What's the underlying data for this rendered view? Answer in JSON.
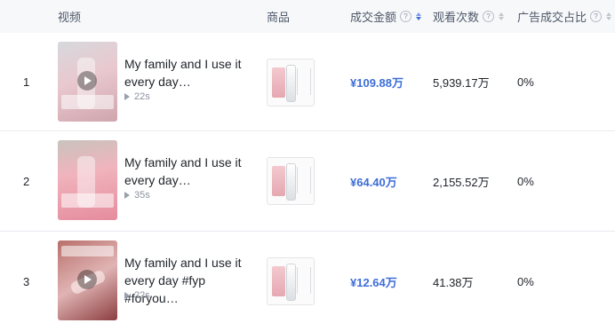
{
  "header": {
    "video": "视频",
    "product": "商品",
    "gmv": "成交金额",
    "views": "观看次数",
    "ad_ratio": "广告成交占比",
    "help_glyph": "?"
  },
  "rows": [
    {
      "rank": "1",
      "title": "My family and I use it\nevery day…",
      "duration": "22s",
      "gmv": "¥109.88万",
      "views": "5,939.17万",
      "ad_ratio": "0%"
    },
    {
      "rank": "2",
      "title": "My family and I use it\nevery day…",
      "duration": "35s",
      "gmv": "¥64.40万",
      "views": "2,155.52万",
      "ad_ratio": "0%"
    },
    {
      "rank": "3",
      "title": "My family and I use it\nevery day #fyp #foryou…",
      "duration": "22s",
      "gmv": "¥12.64万",
      "views": "41.38万",
      "ad_ratio": "0%"
    }
  ],
  "colors": {
    "accent": "#3e6ed8",
    "header_bg": "#f7f8fa",
    "divider": "#e8eaee"
  },
  "icons": {
    "help": "question-circle-icon",
    "sort": "sort-caret-icon",
    "play": "play-icon"
  }
}
